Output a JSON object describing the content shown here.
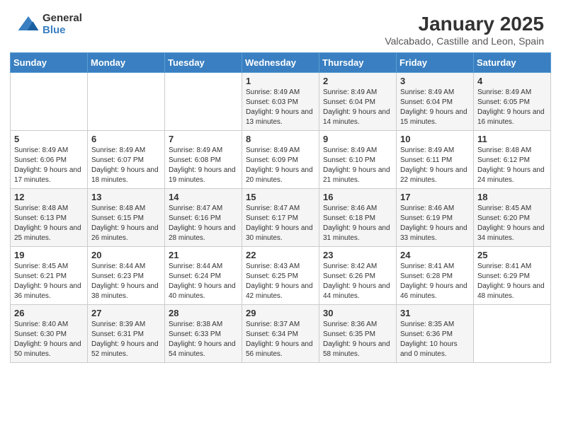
{
  "logo": {
    "general": "General",
    "blue": "Blue"
  },
  "title": "January 2025",
  "subtitle": "Valcabado, Castille and Leon, Spain",
  "weekdays": [
    "Sunday",
    "Monday",
    "Tuesday",
    "Wednesday",
    "Thursday",
    "Friday",
    "Saturday"
  ],
  "weeks": [
    [
      {
        "day": "",
        "info": ""
      },
      {
        "day": "",
        "info": ""
      },
      {
        "day": "",
        "info": ""
      },
      {
        "day": "1",
        "info": "Sunrise: 8:49 AM\nSunset: 6:03 PM\nDaylight: 9 hours\nand 13 minutes."
      },
      {
        "day": "2",
        "info": "Sunrise: 8:49 AM\nSunset: 6:04 PM\nDaylight: 9 hours\nand 14 minutes."
      },
      {
        "day": "3",
        "info": "Sunrise: 8:49 AM\nSunset: 6:04 PM\nDaylight: 9 hours\nand 15 minutes."
      },
      {
        "day": "4",
        "info": "Sunrise: 8:49 AM\nSunset: 6:05 PM\nDaylight: 9 hours\nand 16 minutes."
      }
    ],
    [
      {
        "day": "5",
        "info": "Sunrise: 8:49 AM\nSunset: 6:06 PM\nDaylight: 9 hours\nand 17 minutes."
      },
      {
        "day": "6",
        "info": "Sunrise: 8:49 AM\nSunset: 6:07 PM\nDaylight: 9 hours\nand 18 minutes."
      },
      {
        "day": "7",
        "info": "Sunrise: 8:49 AM\nSunset: 6:08 PM\nDaylight: 9 hours\nand 19 minutes."
      },
      {
        "day": "8",
        "info": "Sunrise: 8:49 AM\nSunset: 6:09 PM\nDaylight: 9 hours\nand 20 minutes."
      },
      {
        "day": "9",
        "info": "Sunrise: 8:49 AM\nSunset: 6:10 PM\nDaylight: 9 hours\nand 21 minutes."
      },
      {
        "day": "10",
        "info": "Sunrise: 8:49 AM\nSunset: 6:11 PM\nDaylight: 9 hours\nand 22 minutes."
      },
      {
        "day": "11",
        "info": "Sunrise: 8:48 AM\nSunset: 6:12 PM\nDaylight: 9 hours\nand 24 minutes."
      }
    ],
    [
      {
        "day": "12",
        "info": "Sunrise: 8:48 AM\nSunset: 6:13 PM\nDaylight: 9 hours\nand 25 minutes."
      },
      {
        "day": "13",
        "info": "Sunrise: 8:48 AM\nSunset: 6:15 PM\nDaylight: 9 hours\nand 26 minutes."
      },
      {
        "day": "14",
        "info": "Sunrise: 8:47 AM\nSunset: 6:16 PM\nDaylight: 9 hours\nand 28 minutes."
      },
      {
        "day": "15",
        "info": "Sunrise: 8:47 AM\nSunset: 6:17 PM\nDaylight: 9 hours\nand 30 minutes."
      },
      {
        "day": "16",
        "info": "Sunrise: 8:46 AM\nSunset: 6:18 PM\nDaylight: 9 hours\nand 31 minutes."
      },
      {
        "day": "17",
        "info": "Sunrise: 8:46 AM\nSunset: 6:19 PM\nDaylight: 9 hours\nand 33 minutes."
      },
      {
        "day": "18",
        "info": "Sunrise: 8:45 AM\nSunset: 6:20 PM\nDaylight: 9 hours\nand 34 minutes."
      }
    ],
    [
      {
        "day": "19",
        "info": "Sunrise: 8:45 AM\nSunset: 6:21 PM\nDaylight: 9 hours\nand 36 minutes."
      },
      {
        "day": "20",
        "info": "Sunrise: 8:44 AM\nSunset: 6:23 PM\nDaylight: 9 hours\nand 38 minutes."
      },
      {
        "day": "21",
        "info": "Sunrise: 8:44 AM\nSunset: 6:24 PM\nDaylight: 9 hours\nand 40 minutes."
      },
      {
        "day": "22",
        "info": "Sunrise: 8:43 AM\nSunset: 6:25 PM\nDaylight: 9 hours\nand 42 minutes."
      },
      {
        "day": "23",
        "info": "Sunrise: 8:42 AM\nSunset: 6:26 PM\nDaylight: 9 hours\nand 44 minutes."
      },
      {
        "day": "24",
        "info": "Sunrise: 8:41 AM\nSunset: 6:28 PM\nDaylight: 9 hours\nand 46 minutes."
      },
      {
        "day": "25",
        "info": "Sunrise: 8:41 AM\nSunset: 6:29 PM\nDaylight: 9 hours\nand 48 minutes."
      }
    ],
    [
      {
        "day": "26",
        "info": "Sunrise: 8:40 AM\nSunset: 6:30 PM\nDaylight: 9 hours\nand 50 minutes."
      },
      {
        "day": "27",
        "info": "Sunrise: 8:39 AM\nSunset: 6:31 PM\nDaylight: 9 hours\nand 52 minutes."
      },
      {
        "day": "28",
        "info": "Sunrise: 8:38 AM\nSunset: 6:33 PM\nDaylight: 9 hours\nand 54 minutes."
      },
      {
        "day": "29",
        "info": "Sunrise: 8:37 AM\nSunset: 6:34 PM\nDaylight: 9 hours\nand 56 minutes."
      },
      {
        "day": "30",
        "info": "Sunrise: 8:36 AM\nSunset: 6:35 PM\nDaylight: 9 hours\nand 58 minutes."
      },
      {
        "day": "31",
        "info": "Sunrise: 8:35 AM\nSunset: 6:36 PM\nDaylight: 10 hours\nand 0 minutes."
      },
      {
        "day": "",
        "info": ""
      }
    ]
  ]
}
